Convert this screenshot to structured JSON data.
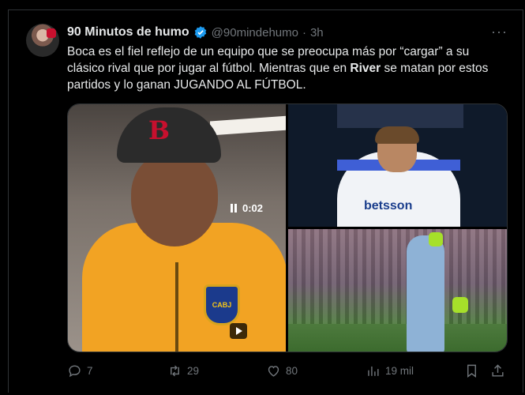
{
  "tweet": {
    "author_name": "90 Minutos de humo",
    "handle": "@90mindehumo",
    "separator": "·",
    "time": "3h",
    "more_label": "···",
    "text_part1": "Boca es el fiel reflejo de un equipo que se preocupa más por “cargar” a su clásico rival que por jugar al fútbol. Mientras que en ",
    "text_bold": "River",
    "text_part2": " se matan por estos partidos y lo ganan JUGANDO AL FÚTBOL.",
    "media": {
      "video_time": "0:02",
      "sponsor_text": "betsson",
      "crest_text": "CABJ"
    },
    "actions": {
      "replies": "7",
      "retweets": "29",
      "likes": "80",
      "views": "19 mil"
    }
  },
  "colors": {
    "background": "#000000",
    "text": "#e7e9ea",
    "muted": "#71767b",
    "verified": "#1d9bf0",
    "border": "#2f3336"
  }
}
